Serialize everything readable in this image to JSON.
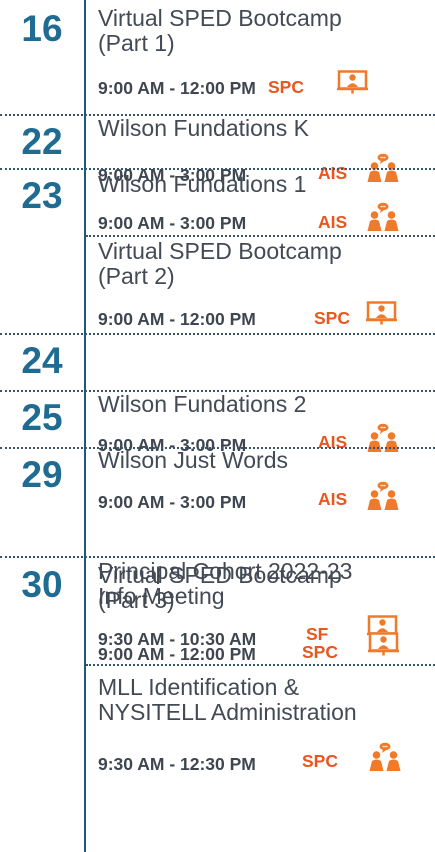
{
  "colors": {
    "day_number": "#1f6b92",
    "title_text": "#444a55",
    "time_text": "#3f4650",
    "location_code": "#e8571e",
    "icon": "#f07a2a",
    "divider": "#1b5b78"
  },
  "rows": [
    {
      "day": "16",
      "events": [
        {
          "title_lines": [
            "Virtual SPED Bootcamp",
            "(Part 1)"
          ],
          "time": "9:00 AM - 12:00 PM",
          "code": "SPC",
          "icon": "virtual-presentation-icon"
        }
      ]
    },
    {
      "day": "22",
      "events": [
        {
          "title_lines": [
            "Wilson Fundations K"
          ],
          "time": "9:00 AM - 3:00 PM",
          "code": "AIS",
          "icon": "in-person-icon"
        }
      ]
    },
    {
      "day": "23",
      "events": [
        {
          "title_lines": [
            "Wilson Fundations 1"
          ],
          "time": "9:00 AM - 3:00 PM",
          "code": "AIS",
          "icon": "in-person-icon"
        },
        {
          "title_lines": [
            "Virtual SPED Bootcamp",
            "(Part 2)"
          ],
          "time": "9:00 AM - 12:00 PM",
          "code": "SPC",
          "icon": "virtual-presentation-icon"
        }
      ]
    },
    {
      "day": "24",
      "events": [
        {
          "title_lines": [
            "Wilson Fundations 2"
          ],
          "time": "9:00 AM - 3:00 PM",
          "code": "AIS",
          "icon": "in-person-icon"
        }
      ]
    },
    {
      "day": "25",
      "events": [
        {
          "title_lines": [
            "Wilson Just Words"
          ],
          "time": "9:00 AM - 3:00 PM",
          "code": "AIS",
          "icon": "in-person-icon"
        }
      ]
    },
    {
      "day": "29",
      "events": [
        {
          "title_lines": [
            "Principal Cohort 2022-23",
            "Info Meeting"
          ],
          "time": "9:30 AM - 10:30 AM",
          "code": "SF",
          "icon": "virtual-presentation-icon"
        }
      ]
    },
    {
      "day": "30",
      "events": [
        {
          "title_lines": [
            "Virtual SPED Bootcamp",
            "(Part 3)"
          ],
          "time": "9:00 AM - 12:00 PM",
          "code": "SPC",
          "icon": "virtual-presentation-icon"
        },
        {
          "title_lines": [
            "MLL Identification &",
            "NYSITELL Administration"
          ],
          "time": "9:30 AM - 12:30 PM",
          "code": "SPC",
          "icon": "in-person-icon"
        }
      ]
    }
  ]
}
